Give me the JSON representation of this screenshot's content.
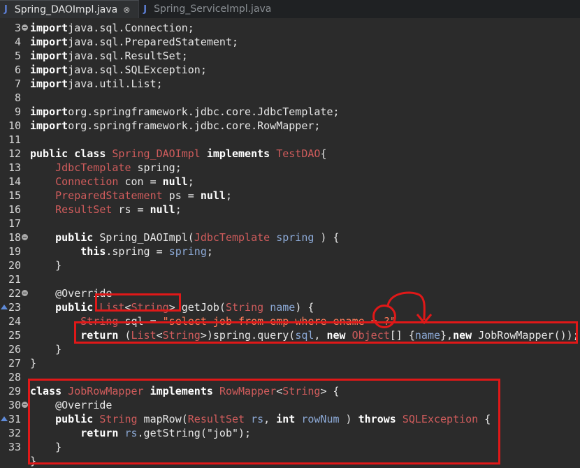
{
  "tabs": [
    {
      "label": "Spring_DAOImpl.java",
      "active": true,
      "close": "⊗"
    },
    {
      "label": "Spring_ServiceImpl.java",
      "active": false
    }
  ],
  "icon_names": {
    "java_file": "java-file-icon",
    "close": "close-icon",
    "fold": "fold-icon",
    "override": "override-marker-icon"
  },
  "lines": [
    {
      "n": "3",
      "fold": true,
      "parts": [
        [
          "kw",
          "import"
        ],
        [
          "",
          "java.sql.Connection;"
        ]
      ]
    },
    {
      "n": "4",
      "parts": [
        [
          "kw",
          "import"
        ],
        [
          "",
          "java.sql.PreparedStatement;"
        ]
      ]
    },
    {
      "n": "5",
      "parts": [
        [
          "kw",
          "import"
        ],
        [
          "",
          "java.sql.ResultSet;"
        ]
      ]
    },
    {
      "n": "6",
      "parts": [
        [
          "kw",
          "import"
        ],
        [
          "",
          "java.sql.SQLException;"
        ]
      ]
    },
    {
      "n": "7",
      "parts": [
        [
          "kw",
          "import"
        ],
        [
          "",
          "java.util.List;"
        ]
      ]
    },
    {
      "n": "8",
      "parts": []
    },
    {
      "n": "9",
      "parts": [
        [
          "kw",
          "import"
        ],
        [
          "",
          "org.springframework.jdbc.core.JdbcTemplate;"
        ]
      ]
    },
    {
      "n": "10",
      "parts": [
        [
          "kw",
          "import"
        ],
        [
          "",
          "org.springframework.jdbc.core.RowMapper;"
        ]
      ]
    },
    {
      "n": "11",
      "parts": []
    },
    {
      "n": "12",
      "parts": [
        [
          "kw",
          "public"
        ],
        [
          "",
          " "
        ],
        [
          "kw",
          "class"
        ],
        [
          "",
          " "
        ],
        [
          "ty",
          "Spring_DAOImpl"
        ],
        [
          "",
          " "
        ],
        [
          "kw",
          "implements"
        ],
        [
          "",
          " "
        ],
        [
          "ty",
          "TestDAO"
        ],
        [
          "",
          "{"
        ]
      ]
    },
    {
      "n": "13",
      "parts": [
        [
          "",
          "    "
        ],
        [
          "ty",
          "JdbcTemplate"
        ],
        [
          "",
          " spring;"
        ]
      ]
    },
    {
      "n": "14",
      "parts": [
        [
          "",
          "    "
        ],
        [
          "ty",
          "Connection"
        ],
        [
          "",
          " con = "
        ],
        [
          "kw",
          "null"
        ],
        [
          "",
          ";"
        ]
      ]
    },
    {
      "n": "15",
      "parts": [
        [
          "",
          "    "
        ],
        [
          "ty",
          "PreparedStatement"
        ],
        [
          "",
          " ps = "
        ],
        [
          "kw",
          "null"
        ],
        [
          "",
          ";"
        ]
      ]
    },
    {
      "n": "16",
      "parts": [
        [
          "",
          "    "
        ],
        [
          "ty",
          "ResultSet"
        ],
        [
          "",
          " rs = "
        ],
        [
          "kw",
          "null"
        ],
        [
          "",
          ";"
        ]
      ]
    },
    {
      "n": "17",
      "parts": []
    },
    {
      "n": "18",
      "fold": true,
      "parts": [
        [
          "",
          "    "
        ],
        [
          "kw",
          "public"
        ],
        [
          "",
          " Spring_DAOImpl("
        ],
        [
          "ty",
          "JdbcTemplate"
        ],
        [
          "",
          " "
        ],
        [
          "par",
          "spring"
        ],
        [
          "",
          " ) {"
        ]
      ]
    },
    {
      "n": "19",
      "parts": [
        [
          "",
          "        "
        ],
        [
          "kw",
          "this"
        ],
        [
          "",
          ".spring = "
        ],
        [
          "par",
          "spring"
        ],
        [
          "",
          ";"
        ]
      ]
    },
    {
      "n": "20",
      "parts": [
        [
          "",
          "    }"
        ]
      ]
    },
    {
      "n": "21",
      "parts": []
    },
    {
      "n": "22",
      "fold": true,
      "parts": [
        [
          "",
          "    "
        ],
        [
          "ann",
          "@Override"
        ]
      ]
    },
    {
      "n": "23",
      "override": true,
      "parts": [
        [
          "",
          "    "
        ],
        [
          "kw",
          "public"
        ],
        [
          "",
          " "
        ],
        [
          "ty",
          "List"
        ],
        [
          "",
          "<"
        ],
        [
          "ty",
          "String"
        ],
        [
          "",
          "> getJob("
        ],
        [
          "ty",
          "String"
        ],
        [
          "",
          " "
        ],
        [
          "par",
          "name"
        ],
        [
          "",
          ") {"
        ]
      ]
    },
    {
      "n": "24",
      "parts": [
        [
          "",
          "        "
        ],
        [
          "ty",
          "String"
        ],
        [
          "",
          " sql = "
        ],
        [
          "str",
          "\"select job from emp where ename = ?\""
        ],
        [
          "",
          ""
        ]
      ]
    },
    {
      "n": "25",
      "parts": [
        [
          "",
          "        "
        ],
        [
          "kw",
          "return"
        ],
        [
          "",
          " ("
        ],
        [
          "ty",
          "List"
        ],
        [
          "",
          "<"
        ],
        [
          "ty",
          "String"
        ],
        [
          "",
          ">)spring.query("
        ],
        [
          "par",
          "sql"
        ],
        [
          "",
          ", "
        ],
        [
          "kw",
          "new"
        ],
        [
          "",
          " "
        ],
        [
          "ty",
          "Object"
        ],
        [
          "",
          "[] {"
        ],
        [
          "par",
          "name"
        ],
        [
          "",
          "},"
        ],
        [
          "kw",
          "new"
        ],
        [
          "",
          " JobRowMapper());"
        ]
      ]
    },
    {
      "n": "26",
      "parts": [
        [
          "",
          "    }"
        ]
      ]
    },
    {
      "n": "27",
      "parts": [
        [
          "",
          "}"
        ]
      ]
    },
    {
      "n": "28",
      "parts": []
    },
    {
      "n": "29",
      "parts": [
        [
          "kw",
          "class"
        ],
        [
          "",
          " "
        ],
        [
          "ty",
          "JobRowMapper"
        ],
        [
          "",
          " "
        ],
        [
          "kw",
          "implements"
        ],
        [
          "",
          " "
        ],
        [
          "ty",
          "RowMapper"
        ],
        [
          "",
          "<"
        ],
        [
          "ty",
          "String"
        ],
        [
          "",
          "> {"
        ]
      ]
    },
    {
      "n": "30",
      "fold": true,
      "parts": [
        [
          "",
          "    "
        ],
        [
          "ann",
          "@Override"
        ]
      ]
    },
    {
      "n": "31",
      "override": true,
      "parts": [
        [
          "",
          "    "
        ],
        [
          "kw",
          "public"
        ],
        [
          "",
          " "
        ],
        [
          "ty",
          "String"
        ],
        [
          "",
          " mapRow("
        ],
        [
          "ty",
          "ResultSet"
        ],
        [
          "",
          " "
        ],
        [
          "par",
          "rs"
        ],
        [
          "",
          ", "
        ],
        [
          "kw",
          "int"
        ],
        [
          "",
          " "
        ],
        [
          "par",
          "rowNum"
        ],
        [
          "",
          " ) "
        ],
        [
          "kw",
          "throws"
        ],
        [
          "",
          " "
        ],
        [
          "ty",
          "SQLException"
        ],
        [
          "",
          " {"
        ]
      ]
    },
    {
      "n": "32",
      "parts": [
        [
          "",
          "        "
        ],
        [
          "kw",
          "return"
        ],
        [
          "",
          " "
        ],
        [
          "par",
          "rs"
        ],
        [
          "",
          ".getString("
        ],
        [
          "",
          "\"job\""
        ],
        [
          "",
          ");"
        ]
      ]
    },
    {
      "n": "33",
      "parts": [
        [
          "",
          "    }"
        ]
      ]
    },
    {
      "n": "",
      "parts": [
        [
          "",
          "}"
        ]
      ]
    }
  ]
}
